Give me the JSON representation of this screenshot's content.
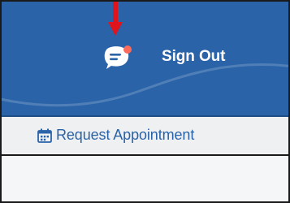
{
  "header": {
    "background": "#2a63a8",
    "chat_icon": "chat-bubble-icon",
    "chat_badge_color": "#ff6b5b",
    "signout_label": "Sign Out"
  },
  "annotation": {
    "arrow_color": "#e0141c",
    "arrow_icon": "down-arrow-annotation"
  },
  "nav": {
    "request_icon": "calendar-icon",
    "request_label": "Request Appointment",
    "link_color": "#2a63a8"
  }
}
